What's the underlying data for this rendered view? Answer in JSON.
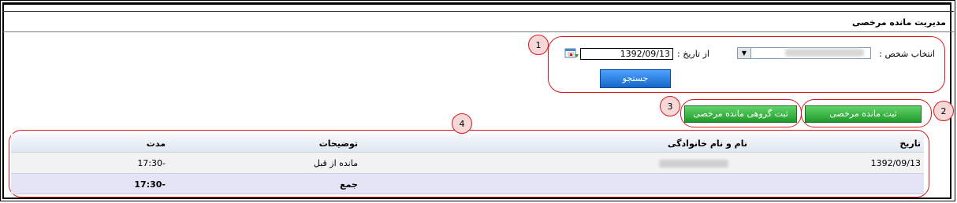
{
  "page": {
    "title": "مدیریت مانده مرخصی"
  },
  "search": {
    "person_label": "انتخاب شخص :",
    "from_date_label": "از تاریخ :",
    "from_date_value": "1392/09/13",
    "search_button": "جستجو"
  },
  "actions": {
    "register_remaining_leave": "ثبت مانده مرخصی",
    "register_group_remaining_leave": "ثبت گروهی مانده مرخصی"
  },
  "callouts": [
    "1",
    "2",
    "3",
    "4"
  ],
  "table": {
    "columns": [
      "تاریخ",
      "نام و نام خانوادگی",
      "توضیحات",
      "مدت"
    ],
    "rows": [
      {
        "date": "1392/09/13",
        "description": "مانده از قبل",
        "duration": "-17:30"
      }
    ],
    "footer": {
      "label": "جمع",
      "total": "-17:30"
    }
  },
  "colors": {
    "callout_red": "#d9191f",
    "callout_fill": "#f7d8d8",
    "button_green": "#2faa38",
    "button_blue": "#1f78dd",
    "footer_row": "#e5e3f6"
  },
  "icons": [
    "calendar-icon",
    "chevron-down-icon"
  ]
}
